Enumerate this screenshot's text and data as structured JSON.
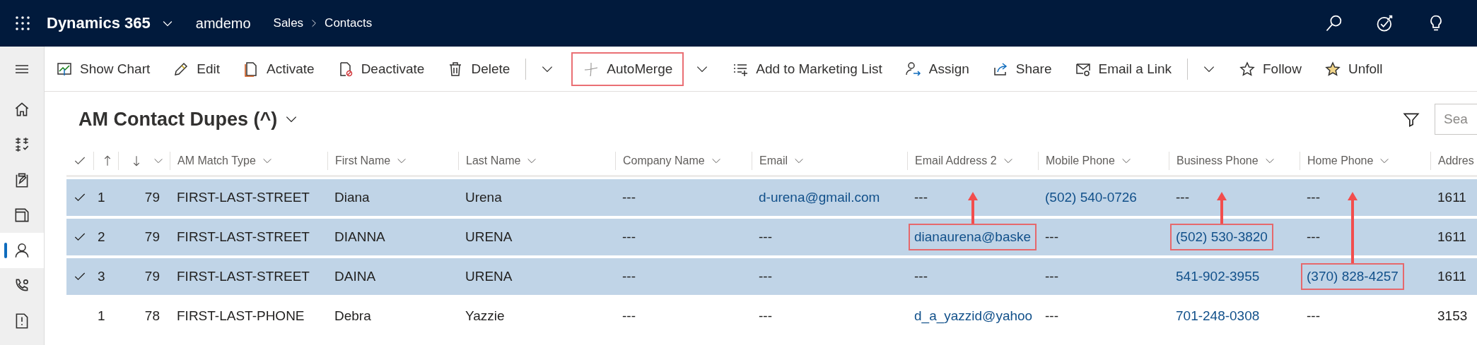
{
  "top_bar": {
    "app_name": "Dynamics 365",
    "environment": "amdemo",
    "breadcrumb": [
      "Sales",
      "Contacts"
    ]
  },
  "sidebar": {
    "items": [
      {
        "selected": false
      },
      {
        "selected": false
      },
      {
        "selected": false
      },
      {
        "selected": false
      },
      {
        "selected": true
      },
      {
        "selected": false
      },
      {
        "selected": false
      }
    ]
  },
  "toolbar": {
    "items": [
      {
        "kind": "button",
        "label": "Show Chart",
        "highlighted": false
      },
      {
        "kind": "button",
        "label": "Edit",
        "highlighted": false
      },
      {
        "kind": "button",
        "label": "Activate",
        "highlighted": false
      },
      {
        "kind": "button",
        "label": "Deactivate",
        "highlighted": false
      },
      {
        "kind": "button",
        "label": "Delete",
        "highlighted": false
      },
      {
        "kind": "split",
        "highlighted": false
      },
      {
        "kind": "button",
        "label": "AutoMerge",
        "highlighted": true
      },
      {
        "kind": "menu",
        "highlighted": false
      },
      {
        "kind": "button",
        "label": "Add to Marketing List",
        "highlighted": false
      },
      {
        "kind": "button",
        "label": "Assign",
        "highlighted": false
      },
      {
        "kind": "button",
        "label": "Share",
        "highlighted": false
      },
      {
        "kind": "button",
        "label": "Email a Link",
        "highlighted": false
      },
      {
        "kind": "split",
        "highlighted": false
      },
      {
        "kind": "button",
        "label": "Follow",
        "highlighted": false
      },
      {
        "kind": "button",
        "label": "Unfoll",
        "highlighted": false
      }
    ]
  },
  "view": {
    "title": "AM Contact Dupes (^)",
    "search": {
      "placeholder": "Sea"
    }
  },
  "grid": {
    "all_selected": true,
    "columns": [
      "AM Match Type",
      "First Name",
      "Last Name",
      "Company Name",
      "Email",
      "Email Address 2",
      "Mobile Phone",
      "Business Phone",
      "Home Phone",
      "Addres"
    ],
    "rows": [
      {
        "selected": true,
        "index": "1",
        "group": "79",
        "cells": [
          {
            "text": "FIRST-LAST-STREET",
            "link": false,
            "boxed": false,
            "arrow": false
          },
          {
            "text": "Diana",
            "link": false,
            "boxed": false,
            "arrow": false
          },
          {
            "text": "Urena",
            "link": false,
            "boxed": false,
            "arrow": false
          },
          {
            "text": "---",
            "link": false,
            "boxed": false,
            "arrow": false
          },
          {
            "text": "d-urena@gmail.com",
            "link": true,
            "boxed": false,
            "arrow": false
          },
          {
            "text": "---",
            "link": false,
            "boxed": false,
            "arrow": false
          },
          {
            "text": "(502) 540-0726",
            "link": true,
            "boxed": false,
            "arrow": false
          },
          {
            "text": "---",
            "link": false,
            "boxed": false,
            "arrow": false
          },
          {
            "text": "---",
            "link": false,
            "boxed": false,
            "arrow": false
          },
          {
            "text": "1611",
            "link": false,
            "boxed": false,
            "arrow": false
          }
        ]
      },
      {
        "selected": true,
        "index": "2",
        "group": "79",
        "cells": [
          {
            "text": "FIRST-LAST-STREET",
            "link": false,
            "boxed": false,
            "arrow": false
          },
          {
            "text": "DIANNA",
            "link": false,
            "boxed": false,
            "arrow": false
          },
          {
            "text": "URENA",
            "link": false,
            "boxed": false,
            "arrow": false
          },
          {
            "text": "---",
            "link": false,
            "boxed": false,
            "arrow": false
          },
          {
            "text": "---",
            "link": false,
            "boxed": false,
            "arrow": false
          },
          {
            "text": "dianaurena@baske",
            "link": true,
            "boxed": true,
            "arrow": true
          },
          {
            "text": "---",
            "link": false,
            "boxed": false,
            "arrow": false
          },
          {
            "text": "(502) 530-3820",
            "link": true,
            "boxed": true,
            "arrow": true
          },
          {
            "text": "---",
            "link": false,
            "boxed": false,
            "arrow": false
          },
          {
            "text": "1611",
            "link": false,
            "boxed": false,
            "arrow": false
          }
        ]
      },
      {
        "selected": true,
        "index": "3",
        "group": "79",
        "cells": [
          {
            "text": "FIRST-LAST-STREET",
            "link": false,
            "boxed": false,
            "arrow": false
          },
          {
            "text": "DAINA",
            "link": false,
            "boxed": false,
            "arrow": false
          },
          {
            "text": "URENA",
            "link": false,
            "boxed": false,
            "arrow": false
          },
          {
            "text": "---",
            "link": false,
            "boxed": false,
            "arrow": false
          },
          {
            "text": "---",
            "link": false,
            "boxed": false,
            "arrow": false
          },
          {
            "text": "---",
            "link": false,
            "boxed": false,
            "arrow": false
          },
          {
            "text": "---",
            "link": false,
            "boxed": false,
            "arrow": false
          },
          {
            "text": "541-902-3955",
            "link": true,
            "boxed": false,
            "arrow": false
          },
          {
            "text": "(370) 828-4257",
            "link": true,
            "boxed": true,
            "arrow": true
          },
          {
            "text": "1611",
            "link": false,
            "boxed": false,
            "arrow": false
          }
        ]
      },
      {
        "selected": false,
        "index": "1",
        "group": "78",
        "cells": [
          {
            "text": "FIRST-LAST-PHONE",
            "link": false,
            "boxed": false,
            "arrow": false
          },
          {
            "text": "Debra",
            "link": false,
            "boxed": false,
            "arrow": false
          },
          {
            "text": "Yazzie",
            "link": false,
            "boxed": false,
            "arrow": false
          },
          {
            "text": "---",
            "link": false,
            "boxed": false,
            "arrow": false
          },
          {
            "text": "---",
            "link": false,
            "boxed": false,
            "arrow": false
          },
          {
            "text": "d_a_yazzid@yahoo",
            "link": true,
            "boxed": false,
            "arrow": false
          },
          {
            "text": "---",
            "link": false,
            "boxed": false,
            "arrow": false
          },
          {
            "text": "701-248-0308",
            "link": true,
            "boxed": false,
            "arrow": false
          },
          {
            "text": "---",
            "link": false,
            "boxed": false,
            "arrow": false
          },
          {
            "text": "3153",
            "link": false,
            "boxed": false,
            "arrow": false
          }
        ]
      }
    ]
  }
}
